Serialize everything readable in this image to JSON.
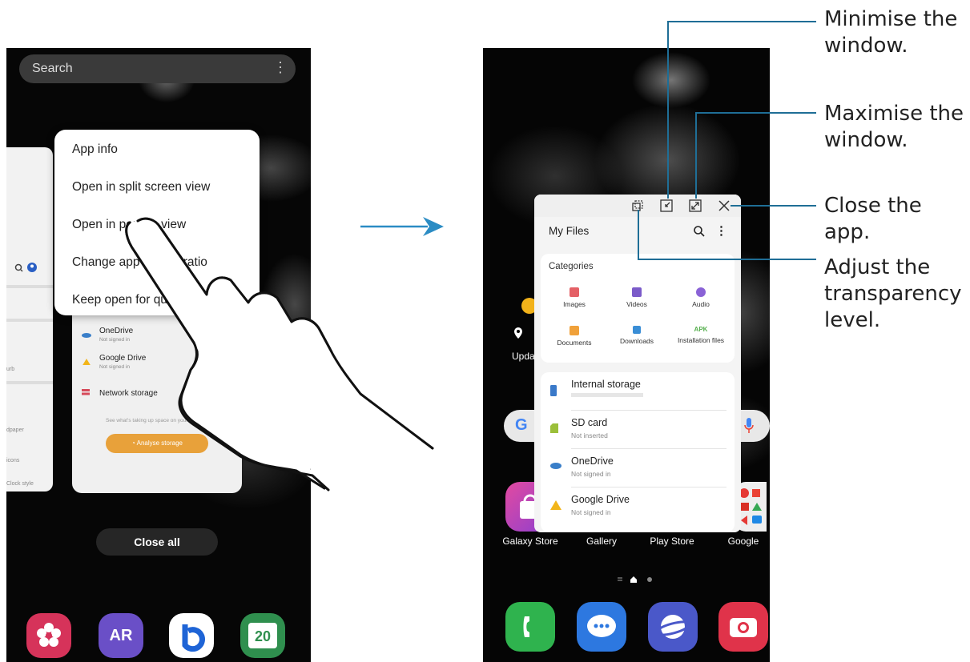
{
  "left_phone": {
    "search_placeholder": "Search",
    "more_icon": "⋮",
    "context_menu": [
      "App info",
      "Open in split screen view",
      "Open in pop-up view",
      "Change app aspect ratio",
      "Keep open for quick launch"
    ],
    "side_card_labels": [
      "urb",
      "dpaper",
      "icons",
      "Clock style"
    ],
    "storage_items": [
      {
        "name": "OneDrive",
        "sub": "Not signed in"
      },
      {
        "name": "Google Drive",
        "sub": "Not signed in"
      },
      {
        "name": "Network storage",
        "sub": ""
      }
    ],
    "storage_hint": "See what's taking up space on your phone.",
    "analyse_label": "Analyse storage",
    "close_all_label": "Close all",
    "dock": [
      {
        "name": "flower-app",
        "label": "",
        "color": "#d6335a"
      },
      {
        "name": "ar-app",
        "label": "AR",
        "color": "#6a4fc7"
      },
      {
        "name": "bixby-app",
        "label": "",
        "color": "#ffffff"
      },
      {
        "name": "calendar-app",
        "label": "20",
        "color": "#2f8f4e"
      }
    ]
  },
  "right_phone": {
    "window_title": "My Files",
    "categories_heading": "Categories",
    "categories": [
      {
        "label": "Images",
        "color": "#e46066"
      },
      {
        "label": "Videos",
        "color": "#7b5bc9"
      },
      {
        "label": "Audio",
        "color": "#8a62d6"
      },
      {
        "label": "Documents",
        "color": "#f0a13a"
      },
      {
        "label": "Downloads",
        "color": "#3a8ed6"
      },
      {
        "label": "Installation files",
        "color": "#57b04f"
      }
    ],
    "apk_label": "APK",
    "storage": [
      {
        "name": "Internal storage",
        "sub": "",
        "color": "#3a79c9"
      },
      {
        "name": "SD card",
        "sub": "Not inserted",
        "color": "#9bbf3a"
      },
      {
        "name": "OneDrive",
        "sub": "Not signed in",
        "color": "#3a7fc9"
      },
      {
        "name": "Google Drive",
        "sub": "Not signed in",
        "color": "#f2b51a"
      }
    ],
    "widget_partial": "Upda",
    "app_labels": [
      "Galaxy Store",
      "Gallery",
      "Play Store",
      "Google"
    ],
    "dock": [
      {
        "name": "phone-app",
        "color": "#2fb34e"
      },
      {
        "name": "messages-app",
        "color": "#2d78e0"
      },
      {
        "name": "internet-app",
        "color": "#4a58c9"
      },
      {
        "name": "camera-app",
        "color": "#e0334a"
      }
    ]
  },
  "callouts": [
    {
      "text": "Minimise the window.",
      "lines": [
        "Minimise the",
        "window."
      ]
    },
    {
      "text": "Maximise the window.",
      "lines": [
        "Maximise the",
        "window."
      ]
    },
    {
      "text": "Close the app.",
      "lines": [
        "Close the app."
      ]
    },
    {
      "text": "Adjust the transparency level.",
      "lines": [
        "Adjust the",
        "transparency",
        "level."
      ]
    }
  ],
  "colors": {
    "callout_line": "#1f6e96",
    "arrow": "#2b8cc4",
    "analyse_button": "#e8a13a"
  }
}
